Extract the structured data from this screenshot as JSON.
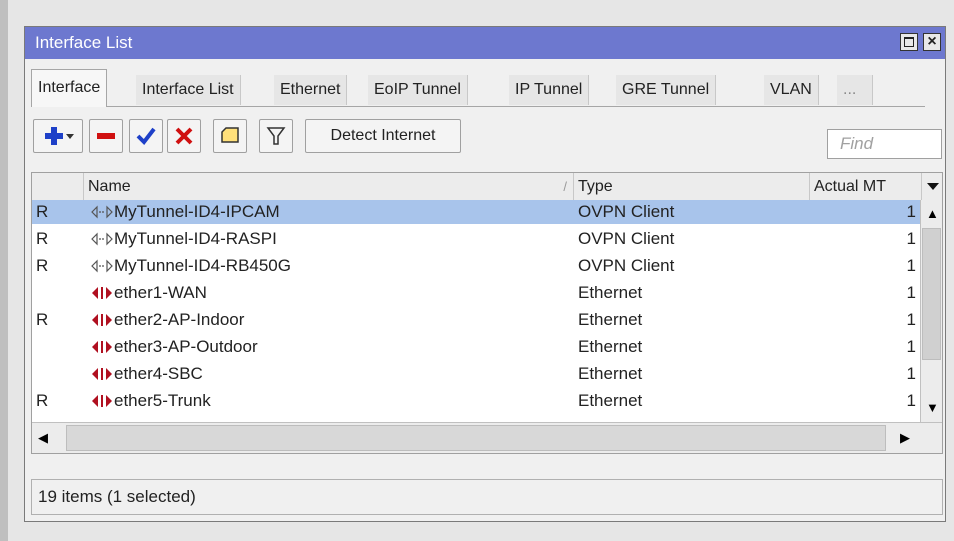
{
  "window": {
    "title": "Interface List"
  },
  "tabs": [
    "Interface",
    "Interface List",
    "Ethernet",
    "EoIP Tunnel",
    "IP Tunnel",
    "GRE Tunnel",
    "VLAN",
    "..."
  ],
  "toolbar": {
    "add_icon": "plus-dropdown-icon",
    "remove_icon": "minus-icon",
    "enable_icon": "check-icon",
    "disable_icon": "x-icon",
    "comment_icon": "note-icon",
    "filter_icon": "filter-icon",
    "detect_label": "Detect Internet",
    "find_placeholder": "Find"
  },
  "table": {
    "columns": [
      "Name",
      "Type",
      "Actual MT"
    ],
    "sort_marker": "/",
    "rows": [
      {
        "flag": "R",
        "icon": "ovpn-icon",
        "name": "MyTunnel-ID4-IPCAM",
        "type": "OVPN Client",
        "mtu": "1",
        "selected": true
      },
      {
        "flag": "R",
        "icon": "ovpn-icon",
        "name": "MyTunnel-ID4-RASPI",
        "type": "OVPN Client",
        "mtu": "1",
        "selected": false
      },
      {
        "flag": "R",
        "icon": "ovpn-icon",
        "name": "MyTunnel-ID4-RB450G",
        "type": "OVPN Client",
        "mtu": "1",
        "selected": false
      },
      {
        "flag": "",
        "icon": "ethernet-icon",
        "name": "ether1-WAN",
        "type": "Ethernet",
        "mtu": "1",
        "selected": false
      },
      {
        "flag": "R",
        "icon": "ethernet-icon",
        "name": "ether2-AP-Indoor",
        "type": "Ethernet",
        "mtu": "1",
        "selected": false
      },
      {
        "flag": "",
        "icon": "ethernet-icon",
        "name": "ether3-AP-Outdoor",
        "type": "Ethernet",
        "mtu": "1",
        "selected": false
      },
      {
        "flag": "",
        "icon": "ethernet-icon",
        "name": "ether4-SBC",
        "type": "Ethernet",
        "mtu": "1",
        "selected": false
      },
      {
        "flag": "R",
        "icon": "ethernet-icon",
        "name": "ether5-Trunk",
        "type": "Ethernet",
        "mtu": "1",
        "selected": false
      }
    ]
  },
  "status": {
    "text": "19 items (1 selected)"
  },
  "colors": {
    "title_bar": "#6d78cf",
    "selected_row": "#a8c4eb",
    "add": "#1e40c8",
    "remove": "#d01010",
    "enable": "#1e40c8",
    "disable": "#d01010"
  }
}
